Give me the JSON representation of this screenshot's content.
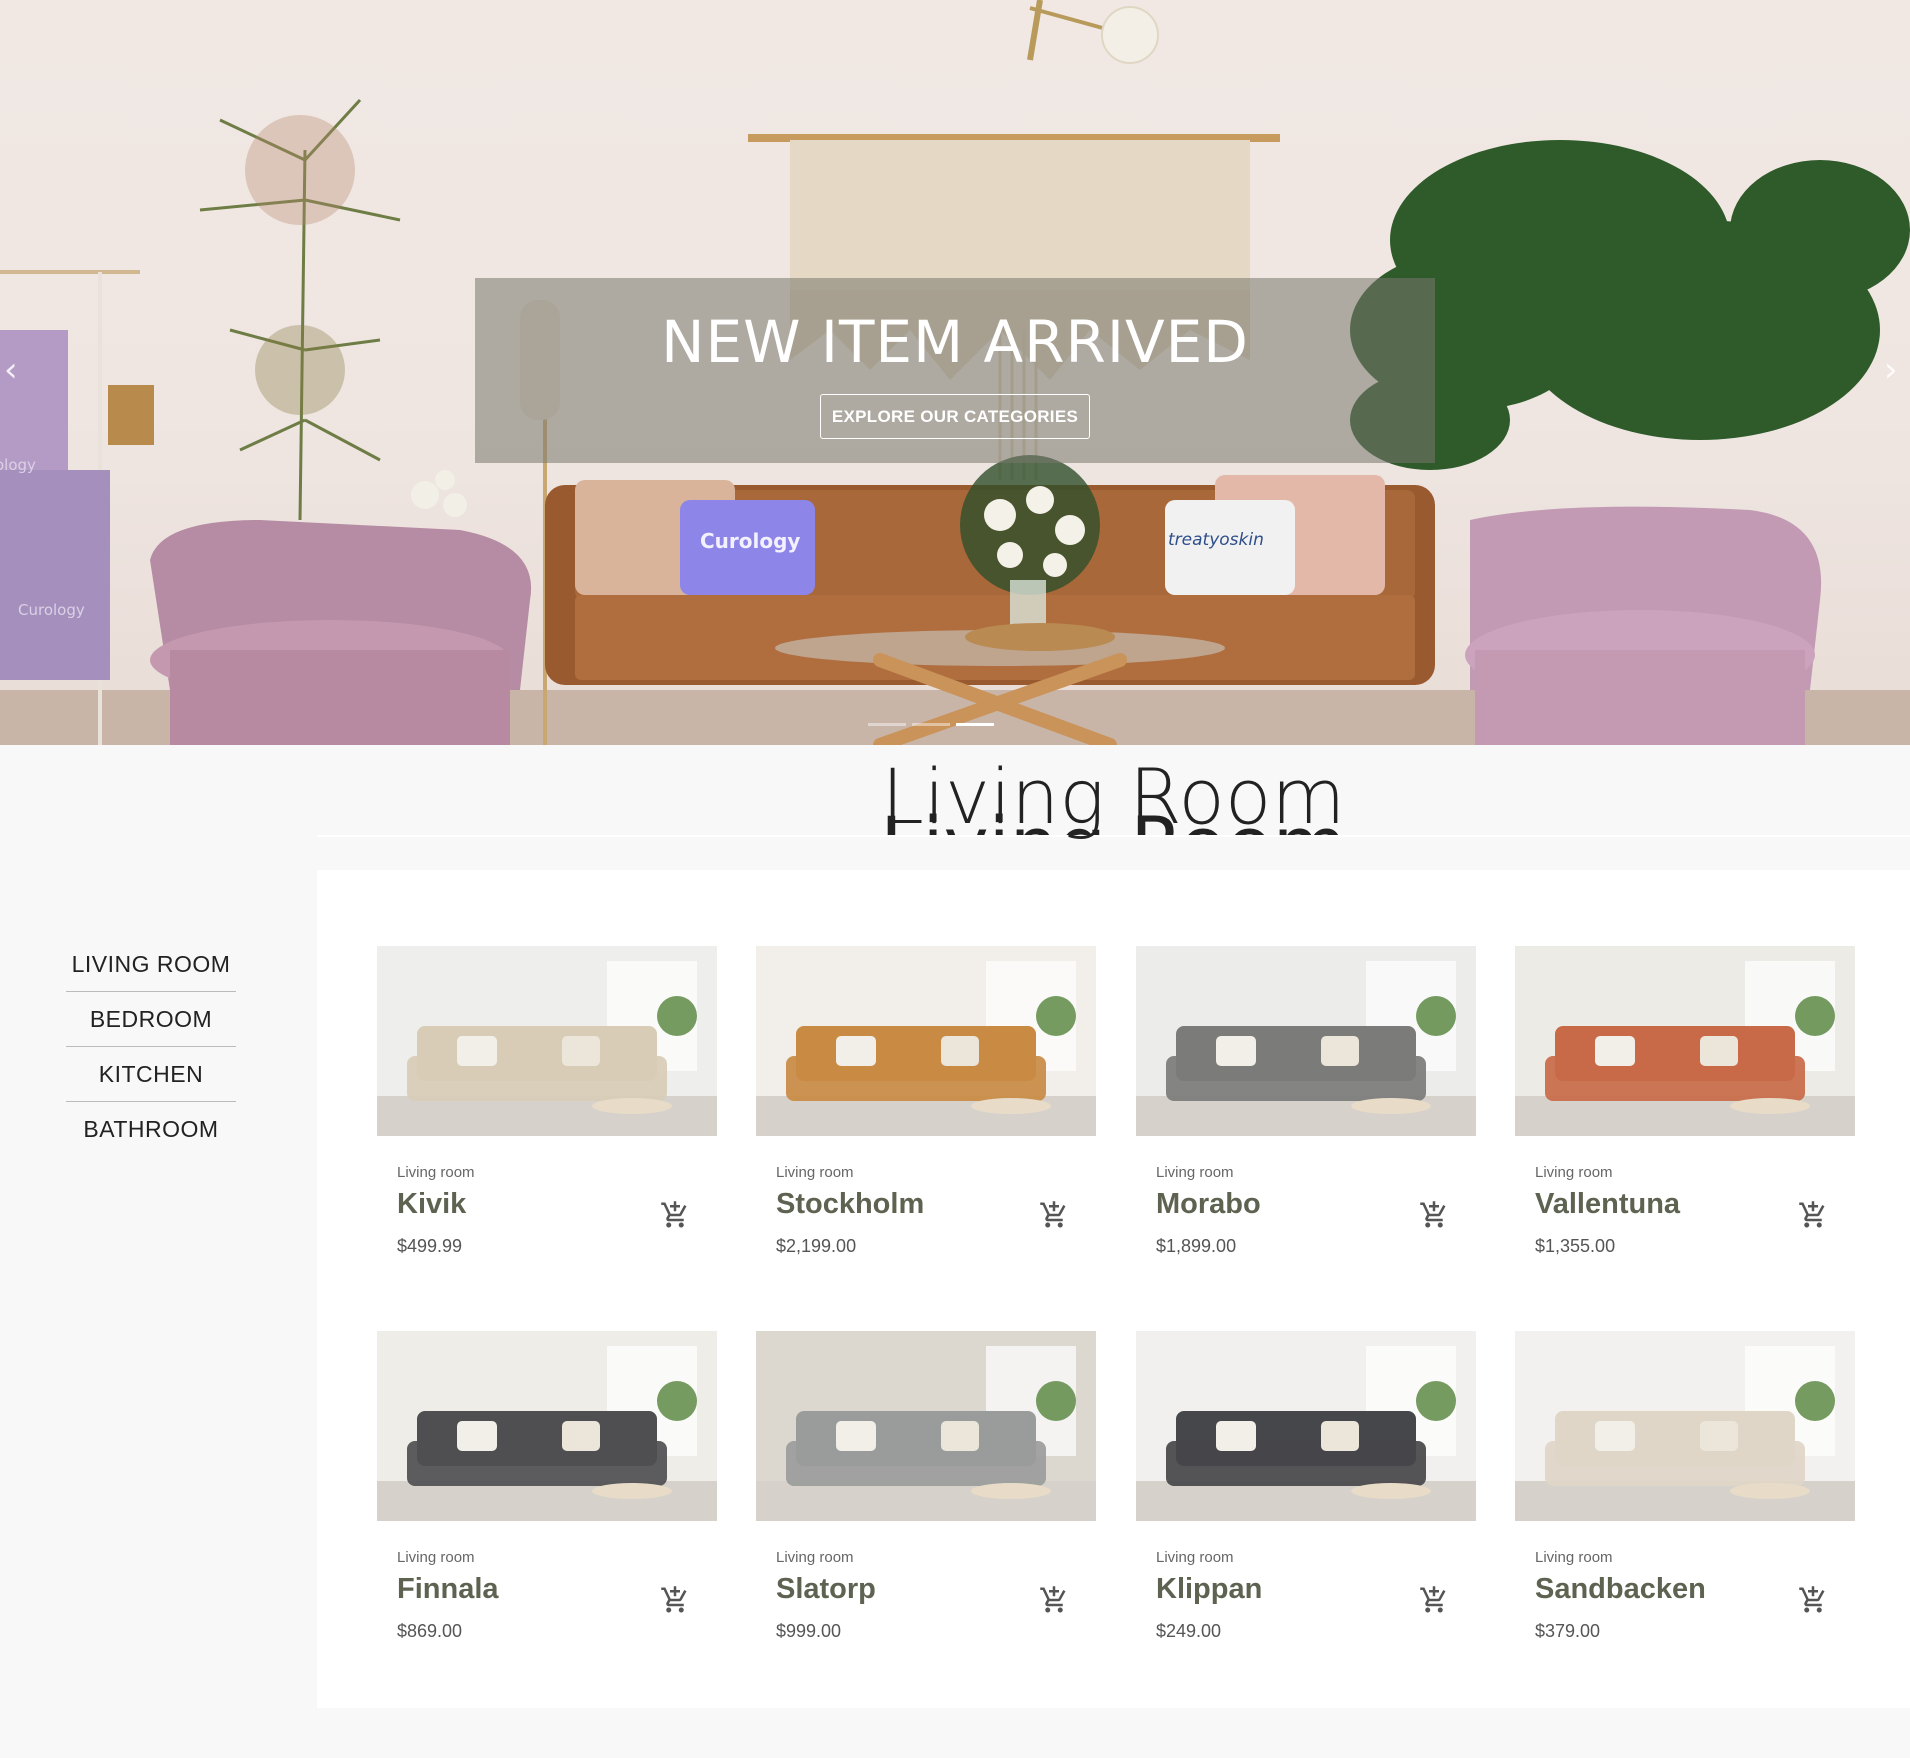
{
  "hero": {
    "caption_title": "NEW ITEM ARRIVED",
    "caption_button": "EXPLORE OUR CATEGORIES",
    "prev_arrow": "‹",
    "next_arrow": "›",
    "pillow_left_text": "Curology",
    "pillow_right_text": "treatyoskin",
    "towel_text_top": "ology",
    "towel_text_bottom": "Curology",
    "slides": 3,
    "active_slide": 3
  },
  "section": {
    "title": "Living Room"
  },
  "sidebar": {
    "items": [
      {
        "label": "LIVING ROOM"
      },
      {
        "label": "BEDROOM"
      },
      {
        "label": "KITCHEN"
      },
      {
        "label": "BATHROOM"
      }
    ]
  },
  "products": [
    {
      "category": "Living room",
      "name": "Kivik",
      "price": "$499.99",
      "sofa_color": "#d8ccb6",
      "room_color": "#eeeeec"
    },
    {
      "category": "Living room",
      "name": "Stockholm",
      "price": "$2,199.00",
      "sofa_color": "#c98a43",
      "room_color": "#f2efea"
    },
    {
      "category": "Living room",
      "name": "Morabo",
      "price": "$1,899.00",
      "sofa_color": "#7b7b79",
      "room_color": "#ececea"
    },
    {
      "category": "Living room",
      "name": "Vallentuna",
      "price": "$1,355.00",
      "sofa_color": "#c86a48",
      "room_color": "#ecebe6"
    },
    {
      "category": "Living room",
      "name": "Finnala",
      "price": "$869.00",
      "sofa_color": "#4f4f52",
      "room_color": "#efede8"
    },
    {
      "category": "Living room",
      "name": "Slatorp",
      "price": "$999.00",
      "sofa_color": "#9a9c9b",
      "room_color": "#dcd8d0"
    },
    {
      "category": "Living room",
      "name": "Klippan",
      "price": "$249.00",
      "sofa_color": "#46474a",
      "room_color": "#f1f0ee"
    },
    {
      "category": "Living room",
      "name": "Sandbacken",
      "price": "$379.00",
      "sofa_color": "#e0d6c8",
      "room_color": "#f2f1ef"
    }
  ],
  "icons": {
    "cart": "add-to-cart-icon"
  },
  "colors": {
    "product_name": "#5e6250",
    "accent_white": "#ffffff"
  }
}
